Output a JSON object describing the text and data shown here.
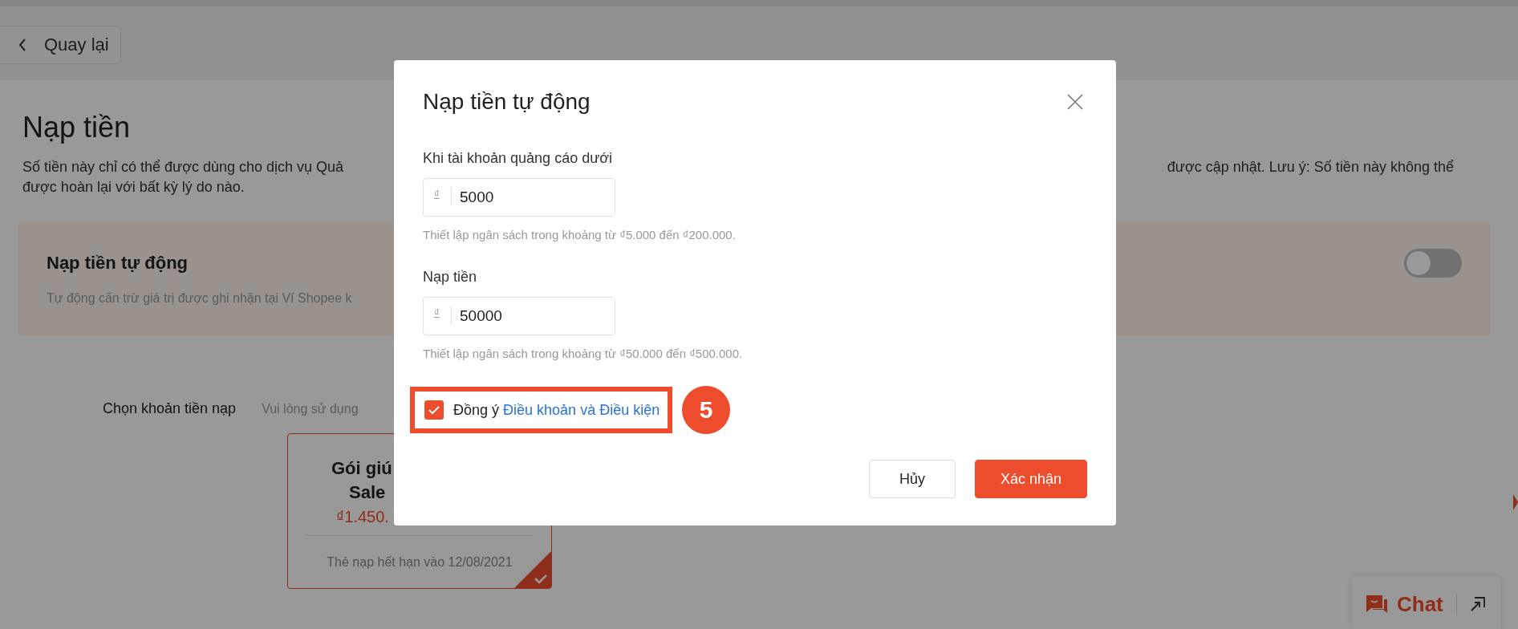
{
  "back_button": {
    "label": "Quay lại"
  },
  "page": {
    "title": "Nạp tiền",
    "description_left": "Số tiền này chỉ có thể được dùng cho dịch vụ Quả",
    "description_right": "được cập nhật. Lưu ý: Số tiền này không thể",
    "description_line2": "được hoàn lại với bất kỳ lý do nào."
  },
  "auto_topup_card": {
    "title": "Nạp tiền tự động",
    "subtitle": "Tự động cấn trừ giá trị được ghi nhận tại Ví Shopee k",
    "on": false
  },
  "amount_section": {
    "label": "Chọn khoản tiền nạp",
    "hint": "Vui lòng sử dụng",
    "packages": [
      {
        "title_line1": "Gói giú",
        "title_line2": "Sale",
        "price": "₫1.450.",
        "expiry": "Thẻ nạp hết hạn vào 12/08/2021",
        "selected": true
      }
    ]
  },
  "chat_widget": {
    "label": "Chat"
  },
  "dialog": {
    "title": "Nạp tiền tự động",
    "fields": [
      {
        "label": "Khi tài khoản quảng cáo dưới",
        "prefix": "₫",
        "value": "5000",
        "hint": "Thiết lập ngân sách trong khoảng từ ₫5.000 đến ₫200.000."
      },
      {
        "label": "Nạp tiền",
        "prefix": "₫",
        "value": "50000",
        "hint": "Thiết lập ngân sách trong khoảng từ ₫50.000 đến ₫500.000."
      }
    ],
    "agreement": {
      "text": "Đồng ý",
      "link": "Điều khoản và Điều kiện",
      "checked": true
    },
    "buttons": [
      {
        "label": "Hủy",
        "kind": "secondary"
      },
      {
        "label": "Xác nhận",
        "kind": "primary"
      }
    ]
  },
  "annotation": {
    "step": "5"
  }
}
